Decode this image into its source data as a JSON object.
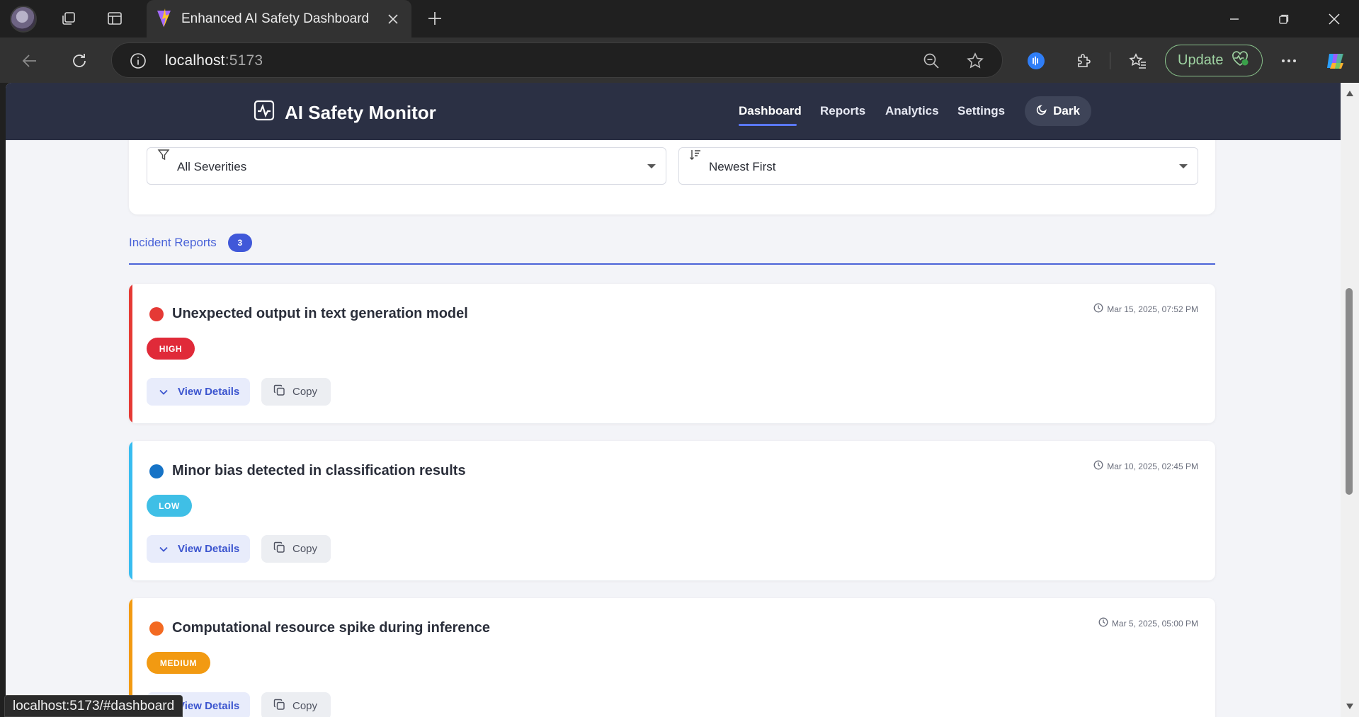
{
  "browser": {
    "tab_title": "Enhanced AI Safety Dashboard",
    "address_host": "localhost",
    "address_port": ":5173",
    "update_label": "Update",
    "status_url": "localhost:5173/#dashboard"
  },
  "app": {
    "brand": "AI Safety Monitor",
    "nav": [
      "Dashboard",
      "Reports",
      "Analytics",
      "Settings"
    ],
    "theme_label": "Dark"
  },
  "filters": {
    "severity_value": "All Severities",
    "sort_value": "Newest First"
  },
  "section": {
    "label": "Incident Reports",
    "count": "3"
  },
  "incidents": [
    {
      "title": "Unexpected output in text generation model",
      "severity": "HIGH",
      "date": "Mar 15, 2025, 07:52 PM",
      "color": "#e53935"
    },
    {
      "title": "Minor bias detected in classification results",
      "severity": "LOW",
      "date": "Mar 10, 2025, 02:45 PM",
      "color": "#1e88e5"
    },
    {
      "title": "Computational resource spike during inference",
      "severity": "MEDIUM",
      "date": "Mar 5, 2025, 05:00 PM",
      "color": "#fb8c00"
    }
  ],
  "actions": {
    "view_details": "View Details",
    "copy": "Copy"
  },
  "colors": {
    "header_bg": "#2b3044",
    "accent": "#4058d9",
    "high": "#e02a39",
    "low": "#3fbfe6",
    "medium": "#f29a12"
  }
}
